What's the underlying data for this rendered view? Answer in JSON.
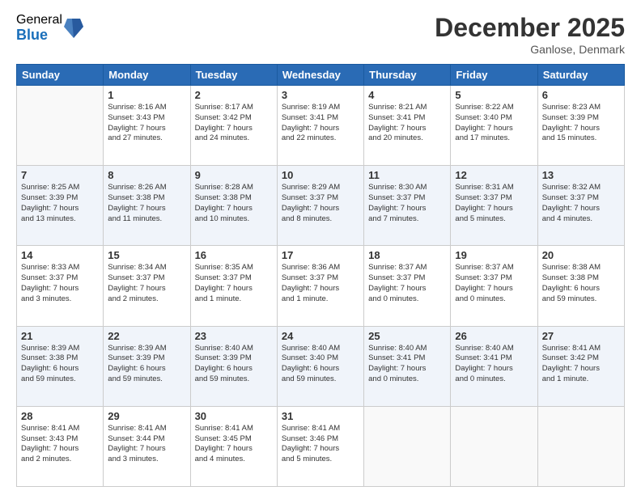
{
  "header": {
    "logo_general": "General",
    "logo_blue": "Blue",
    "month_title": "December 2025",
    "location": "Ganlose, Denmark"
  },
  "days_of_week": [
    "Sunday",
    "Monday",
    "Tuesday",
    "Wednesday",
    "Thursday",
    "Friday",
    "Saturday"
  ],
  "weeks": [
    [
      {
        "day": "",
        "info": ""
      },
      {
        "day": "1",
        "info": "Sunrise: 8:16 AM\nSunset: 3:43 PM\nDaylight: 7 hours\nand 27 minutes."
      },
      {
        "day": "2",
        "info": "Sunrise: 8:17 AM\nSunset: 3:42 PM\nDaylight: 7 hours\nand 24 minutes."
      },
      {
        "day": "3",
        "info": "Sunrise: 8:19 AM\nSunset: 3:41 PM\nDaylight: 7 hours\nand 22 minutes."
      },
      {
        "day": "4",
        "info": "Sunrise: 8:21 AM\nSunset: 3:41 PM\nDaylight: 7 hours\nand 20 minutes."
      },
      {
        "day": "5",
        "info": "Sunrise: 8:22 AM\nSunset: 3:40 PM\nDaylight: 7 hours\nand 17 minutes."
      },
      {
        "day": "6",
        "info": "Sunrise: 8:23 AM\nSunset: 3:39 PM\nDaylight: 7 hours\nand 15 minutes."
      }
    ],
    [
      {
        "day": "7",
        "info": "Sunrise: 8:25 AM\nSunset: 3:39 PM\nDaylight: 7 hours\nand 13 minutes."
      },
      {
        "day": "8",
        "info": "Sunrise: 8:26 AM\nSunset: 3:38 PM\nDaylight: 7 hours\nand 11 minutes."
      },
      {
        "day": "9",
        "info": "Sunrise: 8:28 AM\nSunset: 3:38 PM\nDaylight: 7 hours\nand 10 minutes."
      },
      {
        "day": "10",
        "info": "Sunrise: 8:29 AM\nSunset: 3:37 PM\nDaylight: 7 hours\nand 8 minutes."
      },
      {
        "day": "11",
        "info": "Sunrise: 8:30 AM\nSunset: 3:37 PM\nDaylight: 7 hours\nand 7 minutes."
      },
      {
        "day": "12",
        "info": "Sunrise: 8:31 AM\nSunset: 3:37 PM\nDaylight: 7 hours\nand 5 minutes."
      },
      {
        "day": "13",
        "info": "Sunrise: 8:32 AM\nSunset: 3:37 PM\nDaylight: 7 hours\nand 4 minutes."
      }
    ],
    [
      {
        "day": "14",
        "info": "Sunrise: 8:33 AM\nSunset: 3:37 PM\nDaylight: 7 hours\nand 3 minutes."
      },
      {
        "day": "15",
        "info": "Sunrise: 8:34 AM\nSunset: 3:37 PM\nDaylight: 7 hours\nand 2 minutes."
      },
      {
        "day": "16",
        "info": "Sunrise: 8:35 AM\nSunset: 3:37 PM\nDaylight: 7 hours\nand 1 minute."
      },
      {
        "day": "17",
        "info": "Sunrise: 8:36 AM\nSunset: 3:37 PM\nDaylight: 7 hours\nand 1 minute."
      },
      {
        "day": "18",
        "info": "Sunrise: 8:37 AM\nSunset: 3:37 PM\nDaylight: 7 hours\nand 0 minutes."
      },
      {
        "day": "19",
        "info": "Sunrise: 8:37 AM\nSunset: 3:37 PM\nDaylight: 7 hours\nand 0 minutes."
      },
      {
        "day": "20",
        "info": "Sunrise: 8:38 AM\nSunset: 3:38 PM\nDaylight: 6 hours\nand 59 minutes."
      }
    ],
    [
      {
        "day": "21",
        "info": "Sunrise: 8:39 AM\nSunset: 3:38 PM\nDaylight: 6 hours\nand 59 minutes."
      },
      {
        "day": "22",
        "info": "Sunrise: 8:39 AM\nSunset: 3:39 PM\nDaylight: 6 hours\nand 59 minutes."
      },
      {
        "day": "23",
        "info": "Sunrise: 8:40 AM\nSunset: 3:39 PM\nDaylight: 6 hours\nand 59 minutes."
      },
      {
        "day": "24",
        "info": "Sunrise: 8:40 AM\nSunset: 3:40 PM\nDaylight: 6 hours\nand 59 minutes."
      },
      {
        "day": "25",
        "info": "Sunrise: 8:40 AM\nSunset: 3:41 PM\nDaylight: 7 hours\nand 0 minutes."
      },
      {
        "day": "26",
        "info": "Sunrise: 8:40 AM\nSunset: 3:41 PM\nDaylight: 7 hours\nand 0 minutes."
      },
      {
        "day": "27",
        "info": "Sunrise: 8:41 AM\nSunset: 3:42 PM\nDaylight: 7 hours\nand 1 minute."
      }
    ],
    [
      {
        "day": "28",
        "info": "Sunrise: 8:41 AM\nSunset: 3:43 PM\nDaylight: 7 hours\nand 2 minutes."
      },
      {
        "day": "29",
        "info": "Sunrise: 8:41 AM\nSunset: 3:44 PM\nDaylight: 7 hours\nand 3 minutes."
      },
      {
        "day": "30",
        "info": "Sunrise: 8:41 AM\nSunset: 3:45 PM\nDaylight: 7 hours\nand 4 minutes."
      },
      {
        "day": "31",
        "info": "Sunrise: 8:41 AM\nSunset: 3:46 PM\nDaylight: 7 hours\nand 5 minutes."
      },
      {
        "day": "",
        "info": ""
      },
      {
        "day": "",
        "info": ""
      },
      {
        "day": "",
        "info": ""
      }
    ]
  ]
}
